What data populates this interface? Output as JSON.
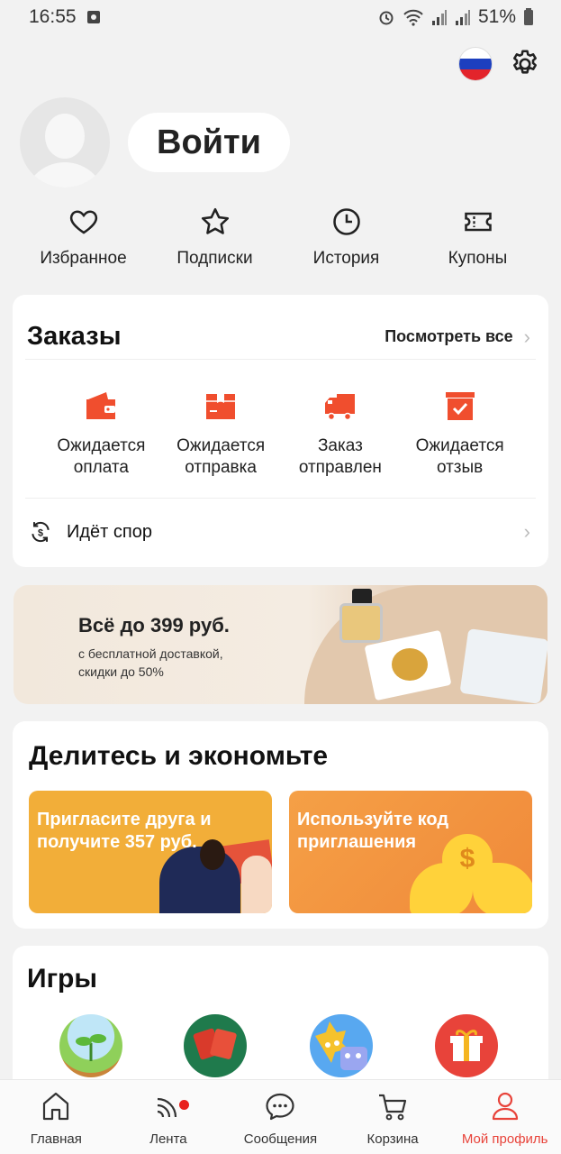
{
  "status_bar": {
    "time": "16:55",
    "battery": "51%"
  },
  "profile": {
    "login_label": "Войти"
  },
  "quick_links": [
    {
      "label": "Избранное",
      "icon": "heart-icon"
    },
    {
      "label": "Подписки",
      "icon": "star-icon"
    },
    {
      "label": "История",
      "icon": "clock-icon"
    },
    {
      "label": "Купоны",
      "icon": "ticket-icon"
    }
  ],
  "orders": {
    "title": "Заказы",
    "see_all": "Посмотреть все",
    "items": [
      {
        "label": "Ожидается\nоплата",
        "icon": "wallet-icon"
      },
      {
        "label": "Ожидается\nотправка",
        "icon": "package-icon"
      },
      {
        "label": "Заказ\nотправлен",
        "icon": "truck-icon"
      },
      {
        "label": "Ожидается\nотзыв",
        "icon": "review-icon"
      }
    ],
    "dispute": "Идёт спор"
  },
  "banner": {
    "title": "Всё до 399 руб.",
    "subtitle_line1": "с бесплатной доставкой,",
    "subtitle_line2": "скидки до 50%"
  },
  "share": {
    "title": "Делитесь и экономьте",
    "promo1": "Пригласите друга и получите 357 руб.",
    "promo2": "Используйте код приглашения",
    "coin_symbol": "$"
  },
  "games": {
    "title": "Игры"
  },
  "bottom_nav": [
    {
      "label": "Главная",
      "icon": "home-icon"
    },
    {
      "label": "Лента",
      "icon": "feed-icon"
    },
    {
      "label": "Сообщения",
      "icon": "chat-icon"
    },
    {
      "label": "Корзина",
      "icon": "cart-icon"
    },
    {
      "label": "Мой профиль",
      "icon": "profile-icon"
    }
  ],
  "colors": {
    "accent": "#e8433a",
    "order_icon": "#f04e2e",
    "background": "#f2f2f2"
  }
}
